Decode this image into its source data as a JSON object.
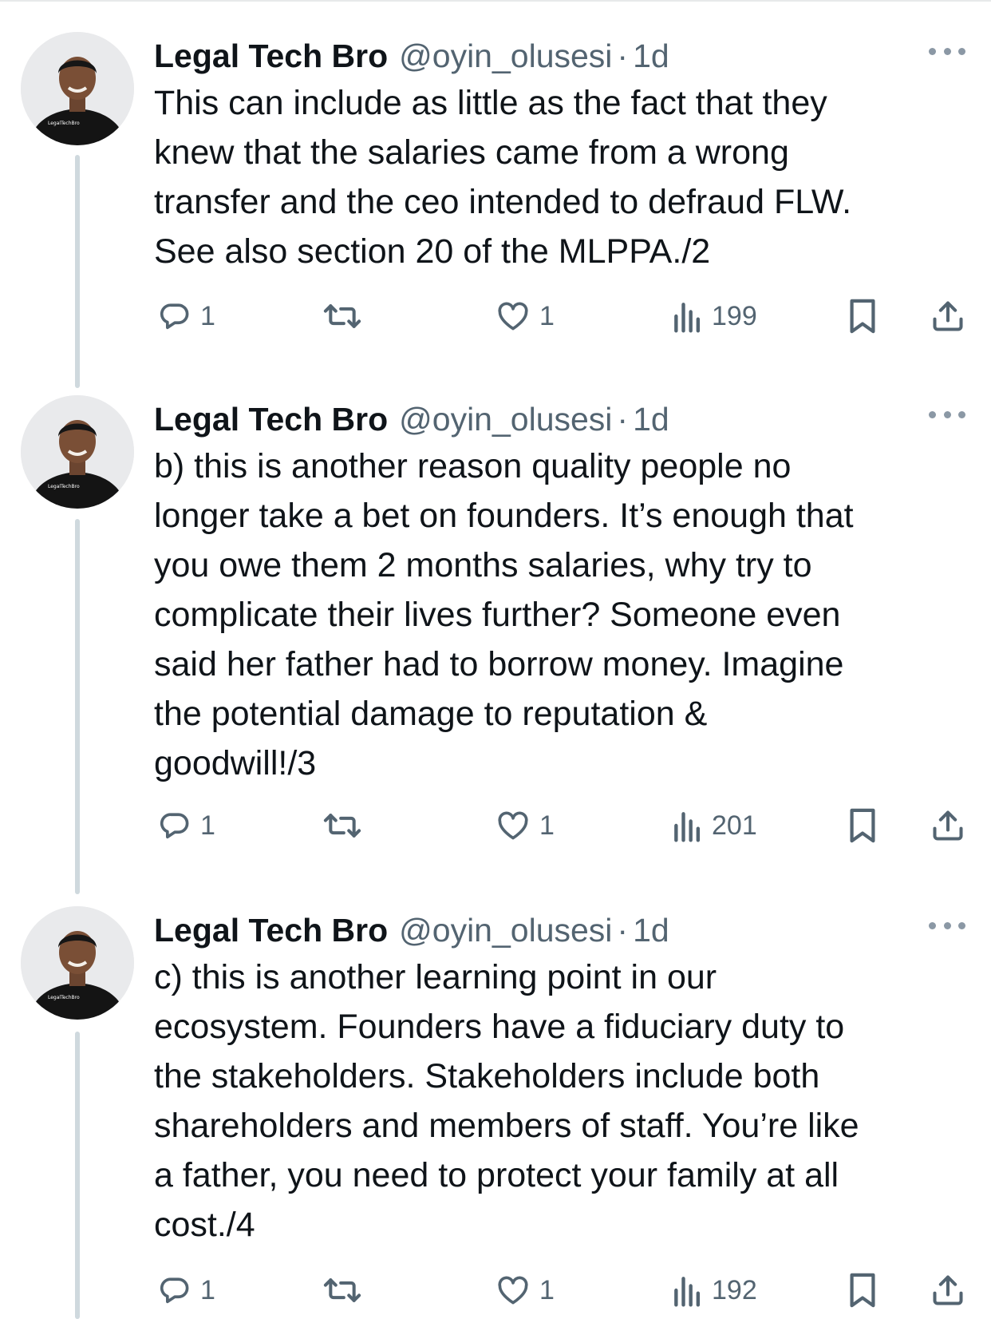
{
  "tweets": [
    {
      "name": "Legal Tech Bro",
      "handle": "@oyin_olusesi",
      "separator": "·",
      "time": "1d",
      "avatar_shirt_text": "LegalTechBro",
      "text": "This can include as little as the fact that they\nknew that the salaries came from a wrong\ntransfer and the ceo intended to defraud FLW.\nSee also section 20 of the MLPPA./2",
      "replies": "1",
      "retweets": "",
      "likes": "1",
      "views": "199"
    },
    {
      "name": "Legal Tech Bro",
      "handle": "@oyin_olusesi",
      "separator": "·",
      "time": "1d",
      "avatar_shirt_text": "LegalTechBro",
      "text": "b) this is another reason quality people no\nlonger take a bet on founders. It’s enough that\nyou owe them 2 months salaries, why try to\ncomplicate their lives further? Someone even\nsaid her father had to borrow money. Imagine\nthe potential damage to reputation &\ngoodwill!/3",
      "replies": "1",
      "retweets": "",
      "likes": "1",
      "views": "201"
    },
    {
      "name": "Legal Tech Bro",
      "handle": "@oyin_olusesi",
      "separator": "·",
      "time": "1d",
      "avatar_shirt_text": "LegalTechBro",
      "text": "c) this is another learning point in our\necosystem. Founders have a fiduciary duty to\nthe stakeholders. Stakeholders include both\nshareholders and members of staff. You’re like\na father, you need to protect your family at all\ncost./4",
      "replies": "1",
      "retweets": "",
      "likes": "1",
      "views": "192"
    }
  ],
  "icons": {
    "reply": "reply-icon",
    "retweet": "retweet-icon",
    "like": "like-icon",
    "views": "views-icon",
    "bookmark": "bookmark-icon",
    "share": "share-icon",
    "more": "more-icon"
  },
  "colors": {
    "text": "#0f1419",
    "secondary": "#536471",
    "thread_line": "#cfd9de",
    "divider": "#e7e9ea"
  }
}
